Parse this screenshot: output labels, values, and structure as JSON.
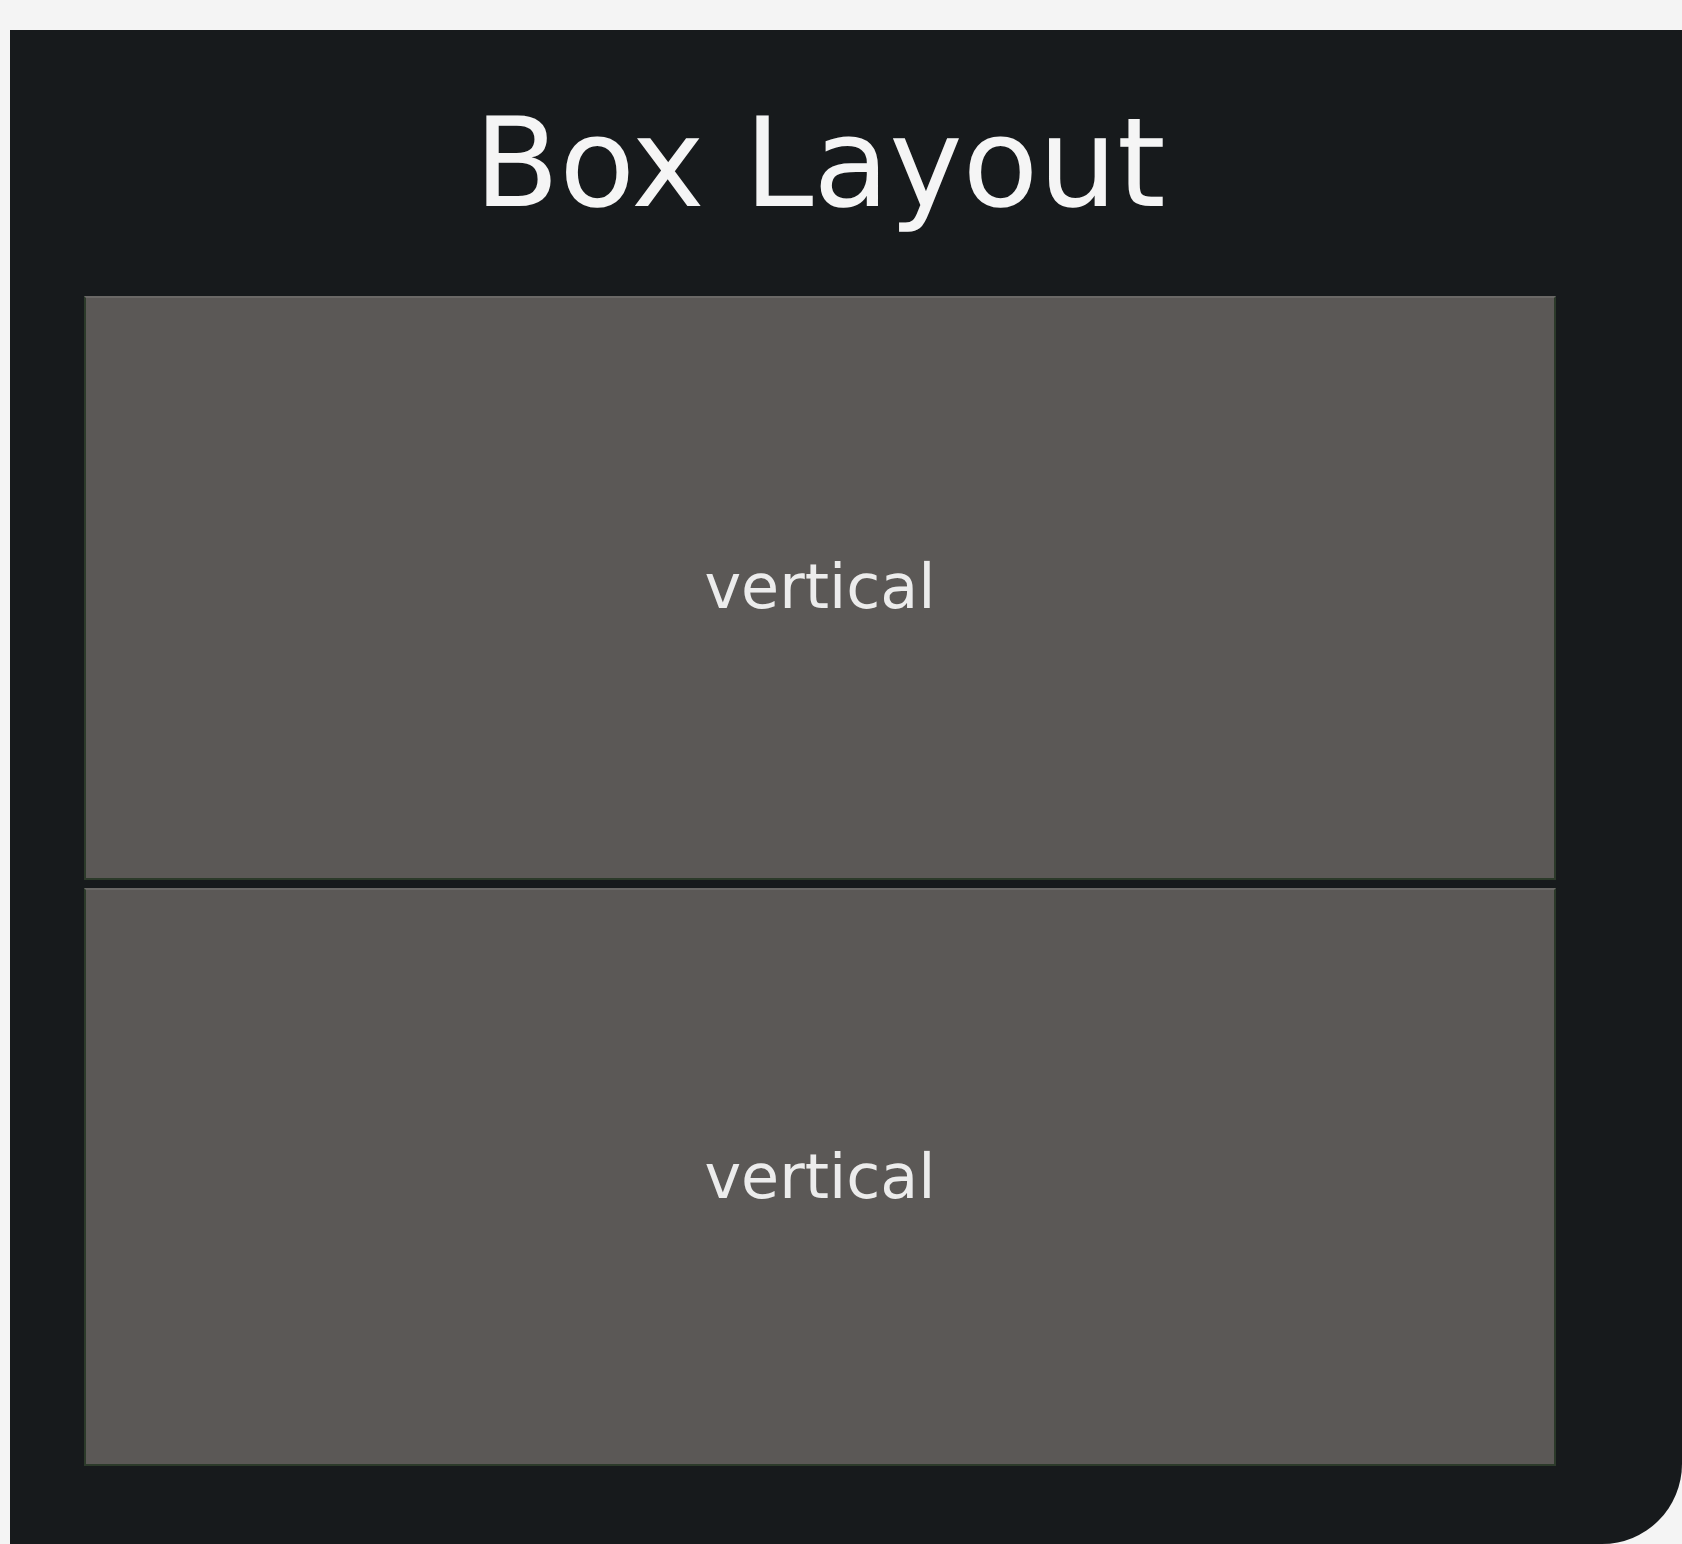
{
  "title": "Box Layout",
  "buttons": [
    {
      "label": "vertical"
    },
    {
      "label": "vertical"
    }
  ]
}
